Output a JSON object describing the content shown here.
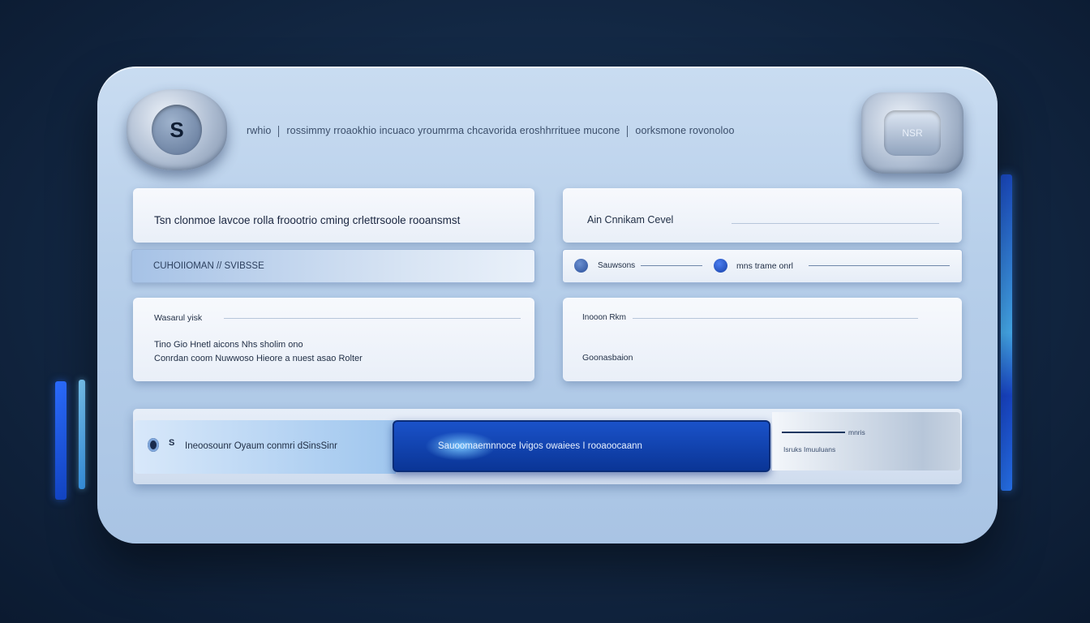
{
  "header": {
    "left_badge_glyph": "S",
    "right_badge_text": "NSR",
    "title_part1": "rwhio",
    "title_part2": "rossimmy rroaokhio incuaco yroumrma chcavorida eroshhrrituee mucone",
    "title_part3": "oorksmone rovonoloo"
  },
  "form": {
    "top_left_text": "Tsn clonmoe lavcoe rolla froootrio cming crlettrsoole rooansmst",
    "top_right_label": "Ain Cnnikam Cevel",
    "left_strip_text": "CUHOIIOMAN // SVIBSSE",
    "radio_1_label": "Sauwsons",
    "radio_2_label": "mns trame onrl",
    "bottom_left_label": "Wasarul yisk",
    "bottom_left_line1": "Tino Gio Hnetl aicons Nhs sholim ono",
    "bottom_left_line2": "Conrdan coom Nuwwoso Hieore a nuest asao Rolter",
    "bottom_right_label": "Inooon Rkm",
    "bottom_right_value": "Goonasbaion"
  },
  "action_bar": {
    "left_icon_glyph": "S",
    "left_text": "Ineoosounr Oyaum conmri dSinsSinr",
    "primary_label": "Sauoomaemnnoce   Ivigos owaiees  I rooaoocaann",
    "right_label_1": "mnris",
    "right_label_2": "Isruks Imuuluans"
  },
  "colors": {
    "background": "#142a47",
    "panel": "#b7cfea",
    "primary": "#1a52c9",
    "accent_glow": "#4bb8ff"
  }
}
